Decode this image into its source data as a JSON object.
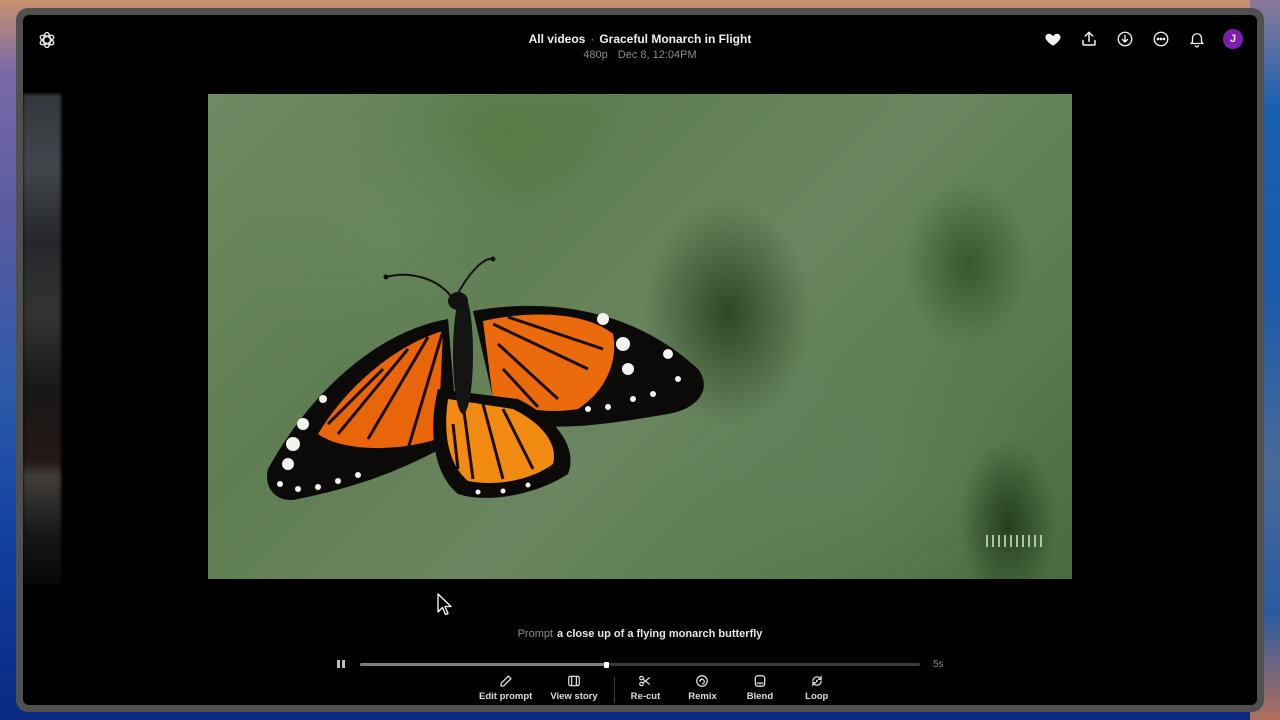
{
  "header": {
    "breadcrumb_root": "All videos",
    "separator": "·",
    "title": "Graceful Monarch in Flight",
    "resolution": "480p",
    "date": "Dec 8, 12:04PM",
    "actions": [
      {
        "name": "favorite",
        "icon": "heart-icon"
      },
      {
        "name": "share",
        "icon": "upload-icon"
      },
      {
        "name": "download",
        "icon": "download-icon"
      },
      {
        "name": "more",
        "icon": "more-horizontal-icon"
      },
      {
        "name": "notifications",
        "icon": "bell-icon"
      }
    ],
    "avatar_initial": "J",
    "avatar_color": "#7a1fb0"
  },
  "video": {
    "subject": "monarch butterfly",
    "watermark_icon": "sora-watermark-icon"
  },
  "prompt": {
    "label": "Prompt",
    "text": "a close up of a flying monarch butterfly"
  },
  "player": {
    "state": "playing",
    "progress": 0.44,
    "duration": "5s"
  },
  "toolbar": {
    "primary": [
      {
        "label": "Edit prompt",
        "icon": "pencil-icon"
      },
      {
        "label": "View story",
        "icon": "storyboard-icon"
      }
    ],
    "secondary": [
      {
        "label": "Re-cut",
        "icon": "scissors-icon"
      },
      {
        "label": "Remix",
        "icon": "remix-icon"
      },
      {
        "label": "Blend",
        "icon": "blend-icon"
      },
      {
        "label": "Loop",
        "icon": "loop-icon"
      }
    ]
  }
}
